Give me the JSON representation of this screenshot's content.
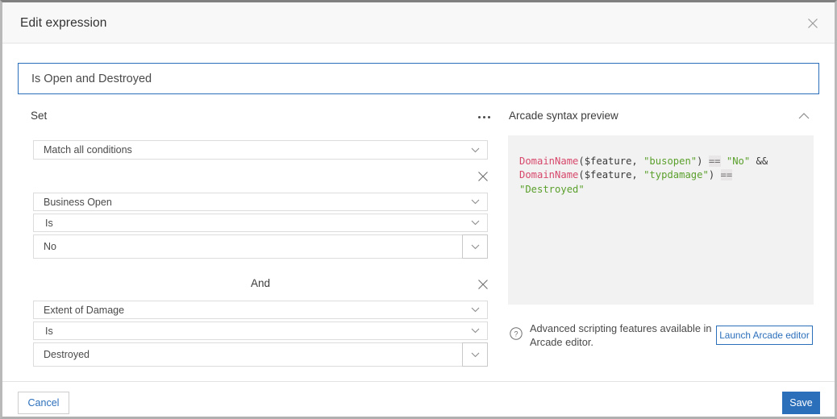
{
  "window": {
    "title": "Edit expression",
    "close_icon": "close-icon"
  },
  "expression": {
    "name_value": "Is Open and Destroyed",
    "name_placeholder": "Expression name"
  },
  "set_panel": {
    "heading": "Set",
    "more_icon": "ellipsis-icon",
    "match_mode": {
      "value": "Match all conditions",
      "chevron_icon": "chevron-down-icon"
    },
    "groups": [
      {
        "join_label": "",
        "remove_icon": "close-icon",
        "field": "Business Open",
        "operator": "Is",
        "value": "No"
      },
      {
        "join_label": "And",
        "remove_icon": "close-icon",
        "field": "Extent of Damage",
        "operator": "Is",
        "value": "Destroyed"
      }
    ]
  },
  "arcade_panel": {
    "heading": "Arcade syntax preview",
    "collapse_icon": "chevron-up-icon",
    "code_text": "DomainName($feature, \"busopen\") == \"No\" &&\nDomainName($feature, \"typdamage\") ==\n\"Destroyed\"",
    "code_tokens": [
      {
        "t": "DomainName",
        "c": "fn"
      },
      {
        "t": "($feature, ",
        "c": "punc"
      },
      {
        "t": "\"busopen\"",
        "c": "str"
      },
      {
        "t": ") ",
        "c": "punc"
      },
      {
        "t": "==",
        "c": "op"
      },
      {
        "t": " ",
        "c": "punc"
      },
      {
        "t": "\"No\"",
        "c": "str"
      },
      {
        "t": " &&\n",
        "c": "punc"
      },
      {
        "t": "DomainName",
        "c": "fn"
      },
      {
        "t": "($feature, ",
        "c": "punc"
      },
      {
        "t": "\"typdamage\"",
        "c": "str"
      },
      {
        "t": ") ",
        "c": "punc"
      },
      {
        "t": "==",
        "c": "op"
      },
      {
        "t": "\n",
        "c": "punc"
      },
      {
        "t": "\"Destroyed\"",
        "c": "str"
      }
    ],
    "help_icon": "question-circle-icon",
    "help_text": "Advanced scripting features available in Arcade editor.",
    "launch_label": "Launch Arcade editor"
  },
  "footer": {
    "cancel_label": "Cancel",
    "save_label": "Save"
  },
  "colors": {
    "accent": "#2b6fbb",
    "titlebar_bg": "#f8f8f8",
    "code_bg": "#f3f2f2",
    "code_fn": "#d6486b",
    "code_string": "#5aa02c",
    "code_operator": "#6f6f6f",
    "border": "#dcdcdc"
  }
}
